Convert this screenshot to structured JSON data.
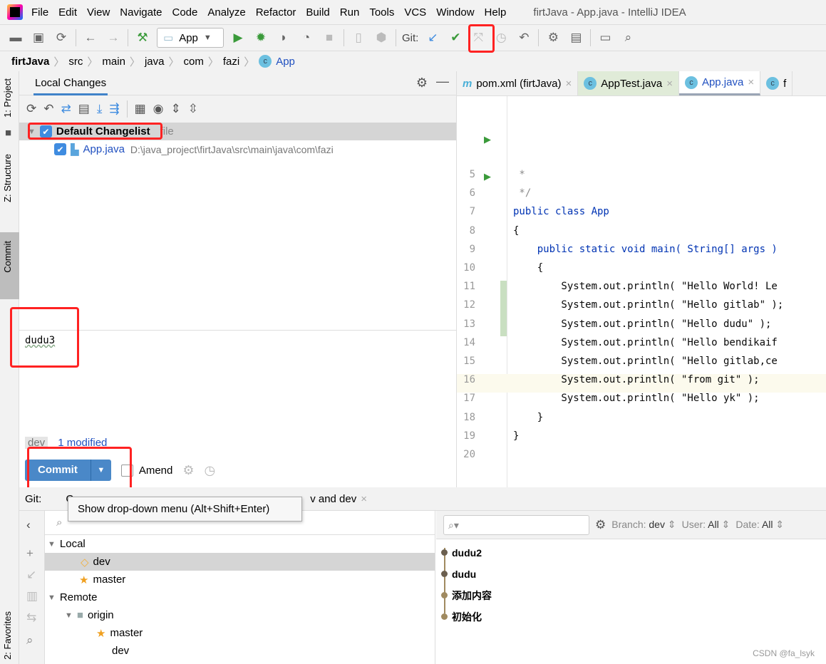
{
  "menubar": {
    "items": [
      "File",
      "Edit",
      "View",
      "Navigate",
      "Code",
      "Analyze",
      "Refactor",
      "Build",
      "Run",
      "Tools",
      "VCS",
      "Window",
      "Help"
    ],
    "title": "firtJava - App.java - IntelliJ IDEA"
  },
  "toolbar": {
    "run_config": "App",
    "git_label": "Git:"
  },
  "breadcrumb": [
    "firtJava",
    "src",
    "main",
    "java",
    "com",
    "fazi",
    "App"
  ],
  "left_stripe": {
    "project": "1: Project",
    "structure": "Z: Structure",
    "commit": "Commit",
    "favorites": "2: Favorites"
  },
  "commit_panel": {
    "tab": "Local Changes",
    "changelist": {
      "name": "Default Changelist",
      "count": "file",
      "checked": true
    },
    "files": [
      {
        "name": "App.java",
        "path": "D:\\java_project\\firtJava\\src\\main\\java\\com\\fazi",
        "checked": true
      }
    ],
    "message": "dudu3",
    "branch": "dev",
    "status": "1 modified",
    "commit_label": "Commit",
    "amend_label": "Amend",
    "amend_checked": false
  },
  "editor": {
    "tabs": [
      {
        "label": "pom.xml (firtJava)"
      },
      {
        "label": "AppTest.java"
      },
      {
        "label": "App.java",
        "active": true
      },
      {
        "label": "f"
      }
    ],
    "lines": [
      {
        "n": "5",
        "text": " *"
      },
      {
        "n": "6",
        "text": " */"
      },
      {
        "n": "7",
        "text": "public class App"
      },
      {
        "n": "8",
        "text": "{"
      },
      {
        "n": "9",
        "text": "    public static void main( String[] args )"
      },
      {
        "n": "10",
        "text": "    {"
      },
      {
        "n": "11",
        "text": "        System.out.println( \"Hello World! Le"
      },
      {
        "n": "12",
        "text": "        System.out.println( \"Hello gitlab\" );"
      },
      {
        "n": "13",
        "text": "        System.out.println( \"Hello dudu\" );"
      },
      {
        "n": "14",
        "text": "        System.out.println( \"Hello bendikaif"
      },
      {
        "n": "15",
        "text": "        System.out.println( \"Hello gitlab,ce"
      },
      {
        "n": "16",
        "text": "        System.out.println( \"from git\" );"
      },
      {
        "n": "17",
        "text": "        System.out.println( \"Hello yk\" );"
      },
      {
        "n": "18",
        "text": "    }"
      },
      {
        "n": "19",
        "text": "}"
      },
      {
        "n": "20",
        "text": ""
      }
    ]
  },
  "bottom": {
    "git_label": "Git:",
    "tab_partial": "C",
    "tab2": "v and dev",
    "tree": [
      {
        "label": "Local",
        "level": 0
      },
      {
        "label": "dev",
        "level": 1,
        "icon": "tag"
      },
      {
        "label": "master",
        "level": 1,
        "icon": "star"
      },
      {
        "label": "Remote",
        "level": 0
      },
      {
        "label": "origin",
        "level": 1,
        "icon": "folder"
      },
      {
        "label": "master",
        "level": 2,
        "icon": "star"
      },
      {
        "label": "dev",
        "level": 2
      }
    ],
    "filters": {
      "branch_label": "Branch:",
      "branch": "dev",
      "user_label": "User:",
      "user": "All",
      "date_label": "Date:",
      "date": "All"
    },
    "commits": [
      "dudu2",
      "dudu",
      "添加内容",
      "初始化"
    ]
  },
  "tooltip": "Show drop-down menu (Alt+Shift+Enter)",
  "watermark": "CSDN @fa_lsyk",
  "colors": {
    "accent": "#4083c9",
    "highlight": "#ff2222"
  }
}
